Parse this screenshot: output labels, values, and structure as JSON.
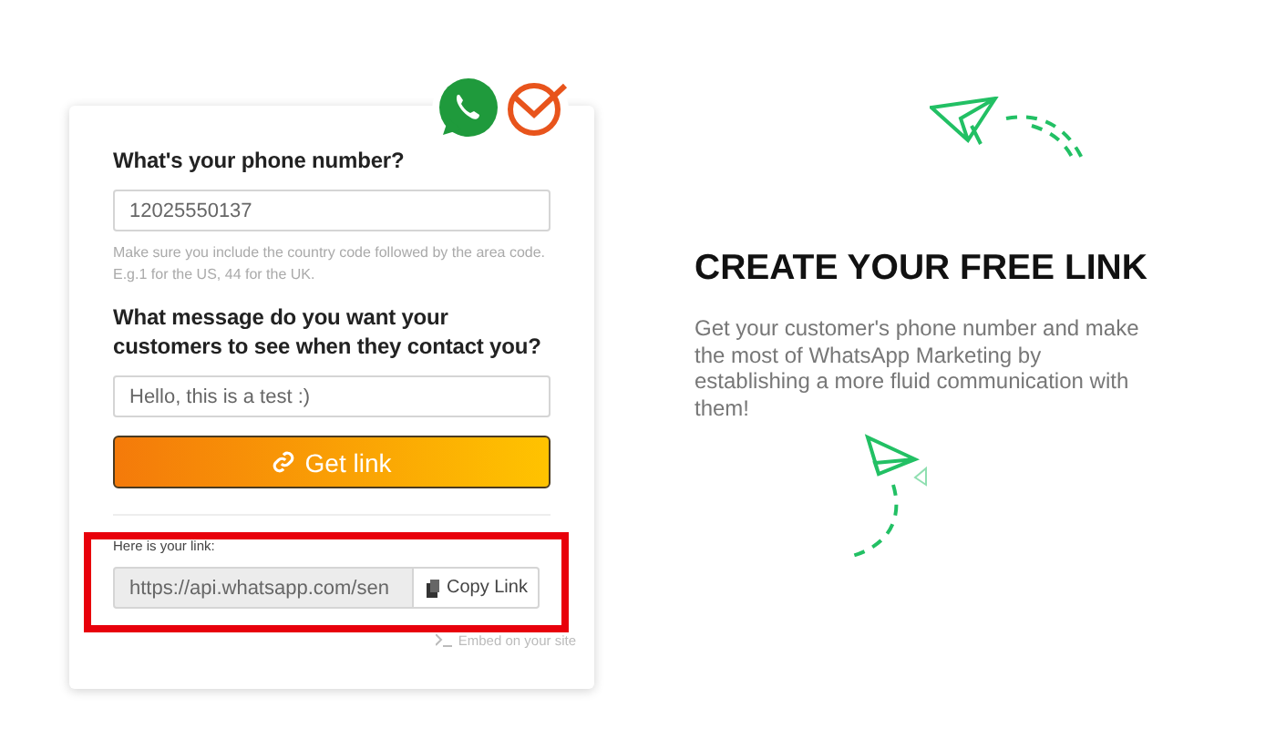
{
  "form": {
    "phone_label": "What's your phone number?",
    "phone": {
      "value": "12025550137"
    },
    "phone_hint": "Make sure you include the country code followed by the area code. E.g.1 for the US, 44 for the UK.",
    "message_label": "What message do you want your customers to see when they contact you?",
    "message": {
      "value": "Hello, this is a test :)"
    },
    "get_link_button": "Get link",
    "link_label": "Here is your link:",
    "link": {
      "value": "https://api.whatsapp.com/sen"
    },
    "copy_button": "Copy Link",
    "embed_link": "Embed on your site"
  },
  "intro": {
    "title": "CREATE YOUR FREE LINK",
    "text": "Get your customer's phone number and make the most of WhatsApp Marketing by establishing a more fluid communication with them!"
  }
}
